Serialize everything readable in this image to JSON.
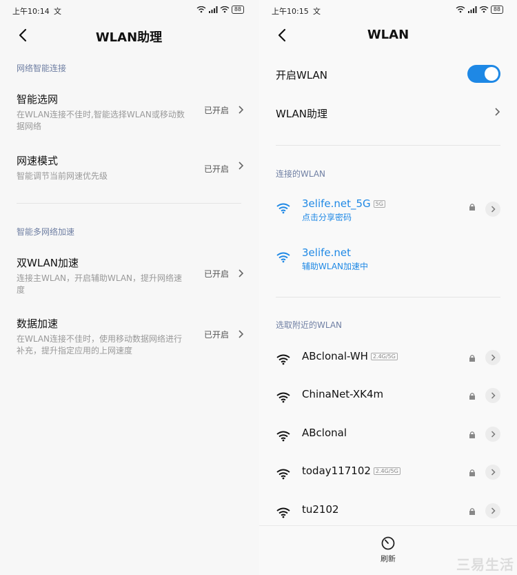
{
  "left": {
    "status_bar": {
      "time": "上午10:14",
      "extra": "文",
      "battery": "88"
    },
    "title": "WLAN助理",
    "section1": "网络智能连接",
    "rows1": [
      {
        "title": "智能选网",
        "desc": "在WLAN连接不佳时,智能选择WLAN或移动数据网络",
        "status": "已开启"
      },
      {
        "title": "网速模式",
        "desc": "智能调节当前网速优先级",
        "status": "已开启"
      }
    ],
    "section2": "智能多网络加速",
    "rows2": [
      {
        "title": "双WLAN加速",
        "desc": "连接主WLAN，开启辅助WLAN，提升网络速度",
        "status": "已开启"
      },
      {
        "title": "数据加速",
        "desc": "在WLAN连接不佳时，使用移动数据网络进行补充，提升指定应用的上网速度",
        "status": "已开启"
      }
    ]
  },
  "right": {
    "status_bar": {
      "time": "上午10:15",
      "extra": "文",
      "battery": "88"
    },
    "title": "WLAN",
    "toggle_label": "开启WLAN",
    "wlan_enabled": true,
    "assistant_label": "WLAN助理",
    "connected_section": "连接的WLAN",
    "connected": [
      {
        "name": "3elife.net_5G",
        "tag": "5G",
        "sub": "点击分享密码",
        "locked": true
      },
      {
        "name": "3elife.net",
        "tag": "",
        "sub": "辅助WLAN加速中",
        "locked": false
      }
    ],
    "nearby_section": "选取附近的WLAN",
    "nearby": [
      {
        "name": "ABclonal-WH",
        "tag": "2.4G/5G"
      },
      {
        "name": "ChinaNet-XK4m",
        "tag": ""
      },
      {
        "name": "ABclonal",
        "tag": ""
      },
      {
        "name": "today117102",
        "tag": "2.4G/5G"
      },
      {
        "name": "tu2102",
        "tag": ""
      }
    ],
    "refresh_label": "刷新"
  },
  "watermark": "三易生活",
  "colors": {
    "accent": "#1e88e5",
    "section": "#6f7fa3"
  }
}
